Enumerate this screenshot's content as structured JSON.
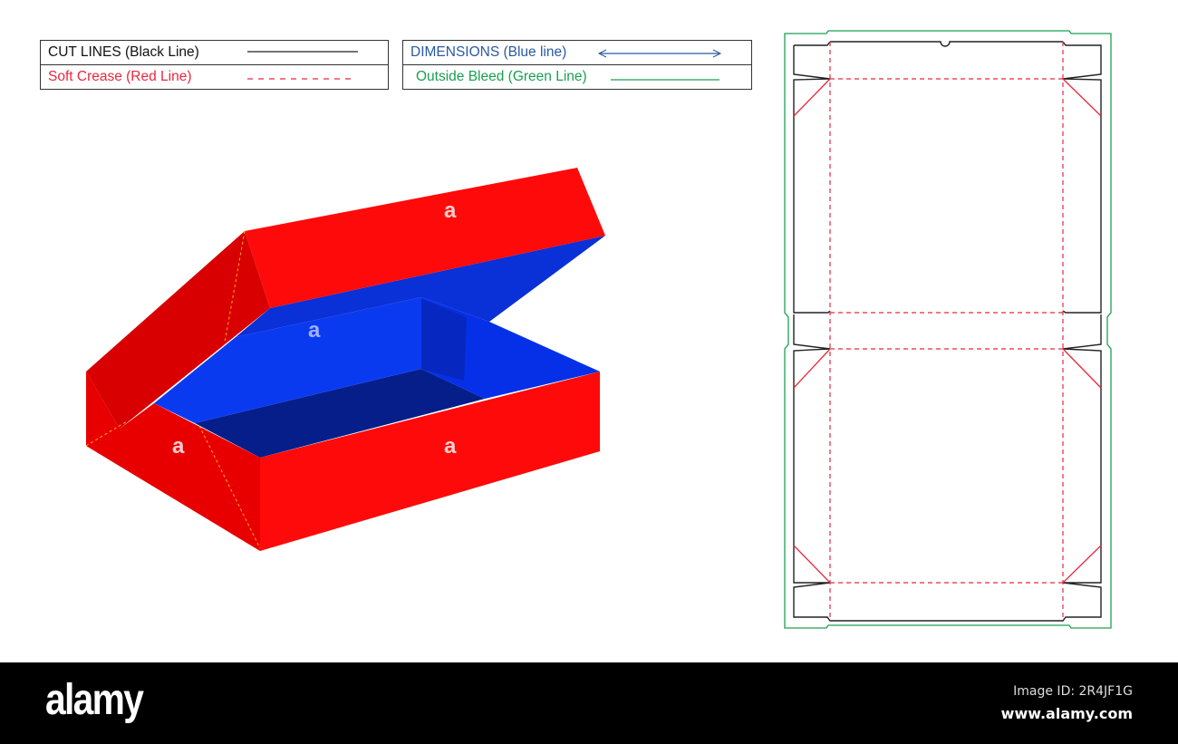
{
  "legend": {
    "cut_lines": "CUT LINES (Black Line)",
    "soft_crease": "Soft Crease (Red Line)",
    "dimensions": "DIMENSIONS (Blue line)",
    "outside_bleed": "Outside Bleed (Green Line)"
  },
  "colors": {
    "cut": "#222222",
    "crease": "#e8283c",
    "dimension": "#2a5aa0",
    "bleed": "#1aa050",
    "box_red": "#ff0a0a",
    "box_red_dark": "#d80000",
    "box_blue": "#0a3af0",
    "box_navy": "#061e8a"
  },
  "box": {
    "face_labels": [
      "a",
      "a",
      "a",
      "a"
    ]
  },
  "footer": {
    "logo": "alamy",
    "image_id": "Image ID: 2R4JF1G",
    "site": "www.alamy.com"
  }
}
